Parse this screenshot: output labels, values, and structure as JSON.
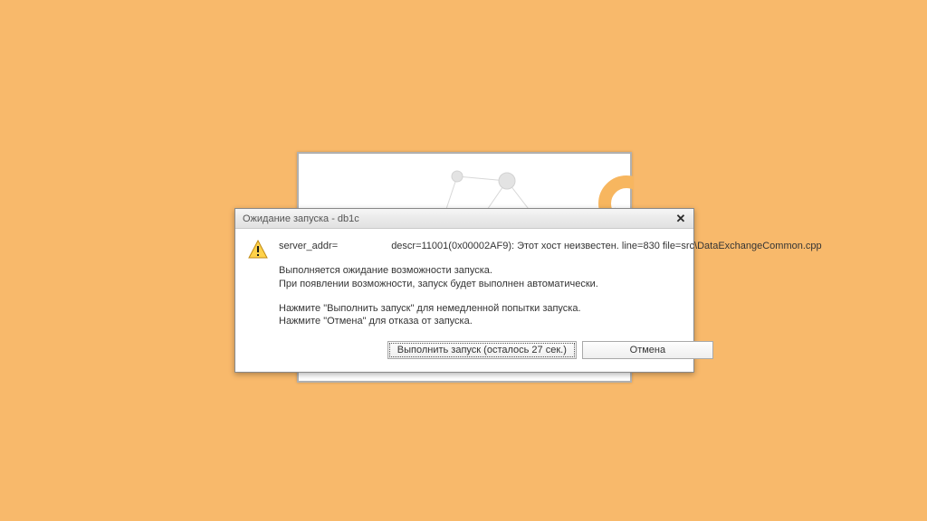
{
  "dialog": {
    "title": "Ожидание запуска - db1c",
    "error": {
      "prefix": "server_addr=",
      "suffix": "descr=11001(0x00002AF9): Этот хост неизвестен.  line=830 file=src\\DataExchangeCommon.cpp"
    },
    "wait1": "Выполняется ожидание возможности запуска.",
    "wait2": "При появлении возможности, запуск будет выполнен автоматически.",
    "instr1": "Нажмите \"Выполнить запуск\" для немедленной попытки запуска.",
    "instr2": "Нажмите \"Отмена\" для отказа от запуска.",
    "launch_btn": "Выполнить запуск (осталось 27 сек.)",
    "cancel_btn": "Отмена",
    "close_glyph": "✕"
  }
}
